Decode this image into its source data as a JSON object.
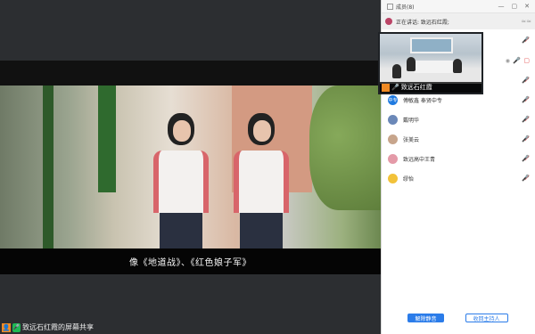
{
  "share": {
    "subtitle": "像《地道战》、《红色娘子军》",
    "label": "致远石红霞的屏幕共享"
  },
  "panel": {
    "title": "成员(8)",
    "speaking_text": "正在讲话: 致远石红霞;",
    "camera_label": "致远石红霞"
  },
  "members": [
    {
      "name": "傅敏鑫 奉贤中专",
      "avatar_text": "中专",
      "avatar_color": "#1f7ae0"
    },
    {
      "name": "戴明华",
      "avatar_text": "",
      "avatar_color": "#6b88b8"
    },
    {
      "name": "张美云",
      "avatar_text": "",
      "avatar_color": "#c7a58c"
    },
    {
      "name": "致远高中王青",
      "avatar_text": "",
      "avatar_color": "#e49aa8"
    },
    {
      "name": "缪怡",
      "avatar_text": "",
      "avatar_color": "#f2c23a"
    }
  ],
  "buttons": {
    "unmute_all": "解除静音",
    "reclaim_host": "收回主持人"
  },
  "colors": {
    "accent": "#2b7ce9",
    "muted": "#e34a4a",
    "active_mic": "#27a84a"
  }
}
